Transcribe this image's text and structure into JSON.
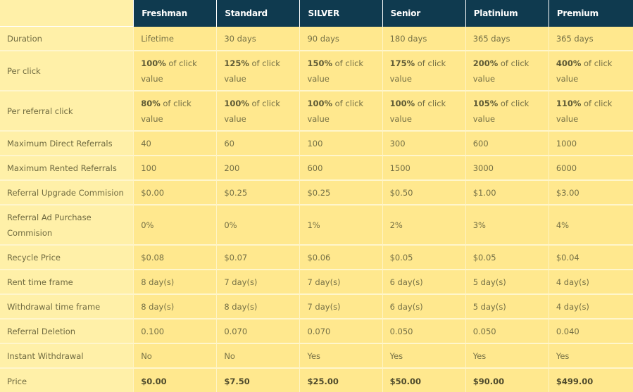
{
  "header": {
    "plans": [
      "Freshman",
      "Standard",
      "SILVER",
      "Senior",
      "Platinium",
      "Premium"
    ]
  },
  "rows": [
    {
      "label": "Duration",
      "values": [
        "Lifetime",
        "30 days",
        "90 days",
        "180 days",
        "365 days",
        "365 days"
      ]
    },
    {
      "label": "Per click",
      "bold": [
        "100%",
        "125%",
        "150%",
        "175%",
        "200%",
        "400%"
      ],
      "suffix": " of click value"
    },
    {
      "label": "Per referral click",
      "bold": [
        "80%",
        "100%",
        "100%",
        "100%",
        "105%",
        "110%"
      ],
      "suffix": " of click value"
    },
    {
      "label": "Maximum Direct Referrals",
      "values": [
        "40",
        "60",
        "100",
        "300",
        "600",
        "1000"
      ]
    },
    {
      "label": "Maximum Rented Referrals",
      "values": [
        "100",
        "200",
        "600",
        "1500",
        "3000",
        "6000"
      ]
    },
    {
      "label": "Referral Upgrade Commision",
      "values": [
        "$0.00",
        "$0.25",
        "$0.25",
        "$0.50",
        "$1.00",
        "$3.00"
      ]
    },
    {
      "label": "Referral Ad Purchase Commision",
      "values": [
        "0%",
        "0%",
        "1%",
        "2%",
        "3%",
        "4%"
      ]
    },
    {
      "label": "Recycle Price",
      "values": [
        "$0.08",
        "$0.07",
        "$0.06",
        "$0.05",
        "$0.05",
        "$0.04"
      ]
    },
    {
      "label": "Rent time frame",
      "values": [
        "8 day(s)",
        "7 day(s)",
        "7 day(s)",
        "6 day(s)",
        "5 day(s)",
        "4 day(s)"
      ]
    },
    {
      "label": "Withdrawal time frame",
      "values": [
        "8 day(s)",
        "8 day(s)",
        "7 day(s)",
        "6 day(s)",
        "5 day(s)",
        "4 day(s)"
      ]
    },
    {
      "label": "Referral Deletion",
      "values": [
        "0.100",
        "0.070",
        "0.070",
        "0.050",
        "0.050",
        "0.040"
      ]
    },
    {
      "label": "Instant Withdrawal",
      "values": [
        "No",
        "No",
        "Yes",
        "Yes",
        "Yes",
        "Yes"
      ]
    },
    {
      "label": "Price",
      "values": [
        "$0.00",
        "$7.50",
        "$25.00",
        "$50.00",
        "$90.00",
        "$499.00"
      ]
    }
  ],
  "colors": {
    "header_bg": "#0f3a4f",
    "cell_bg": "#ffe88e",
    "label_bg": "#fff0a8",
    "text": "#757045"
  }
}
